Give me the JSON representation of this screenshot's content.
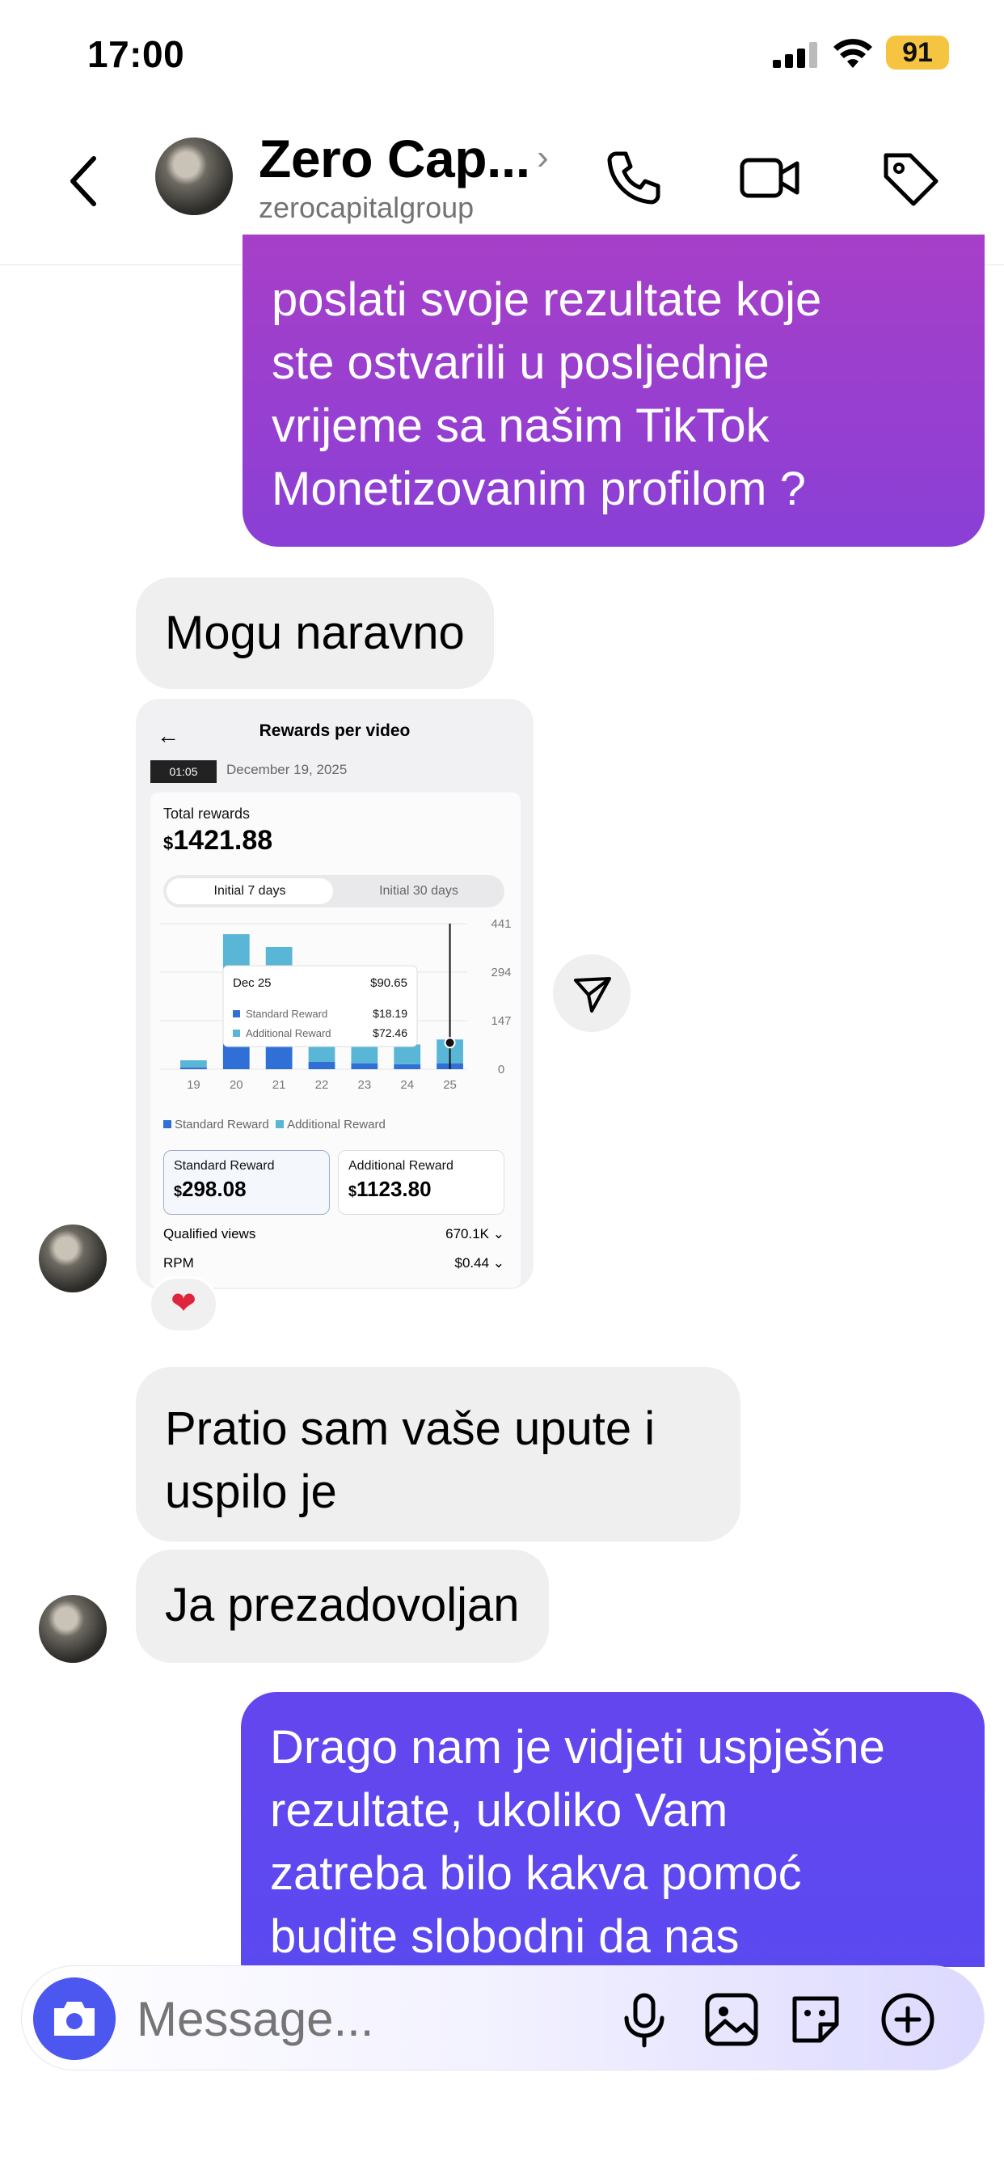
{
  "status_bar": {
    "time": "17:00",
    "battery": "91"
  },
  "header": {
    "title": "Zero Cap...",
    "subtitle": "zerocapitalgroup"
  },
  "messages": {
    "m1_lines": [
      "poslati svoje rezultate koje",
      "ste ostvarili u posljednje",
      "vrijeme sa našim TikTok",
      "Monetizovanim profilom ?"
    ],
    "m2": "Mogu naravno",
    "m4_lines": [
      "Pratio sam vaše upute i",
      "uspilo je"
    ],
    "m5": "Ja prezadovoljan",
    "m6_lines": [
      "Drago nam je vidjeti uspješne",
      "rezultate, ukoliko Vam",
      "zatreba bilo kakva pomoć",
      "budite slobodni da nas"
    ]
  },
  "shared_screenshot": {
    "title": "Rewards per video",
    "thumb_time": "01:05",
    "date": "December 19, 2025",
    "total_label": "Total rewards",
    "total_currency": "$",
    "total_value": "1421.88",
    "tab_active": "Initial 7 days",
    "tab_inactive": "Initial 30 days",
    "tooltip": {
      "date": "Dec 25",
      "total": "$90.65",
      "standard_label": "Standard Reward",
      "standard_value": "$18.19",
      "additional_label": "Additional Reward",
      "additional_value": "$72.46"
    },
    "legend_standard": "Standard Reward",
    "legend_additional": "Additional Reward",
    "standard_card_label": "Standard Reward",
    "standard_card_value": "298.08",
    "additional_card_label": "Additional Reward",
    "additional_card_value": "1123.80",
    "qualified_views_label": "Qualified views",
    "qualified_views_value": "670.1K",
    "rpm_label": "RPM",
    "rpm_value": "$0.44",
    "colors": {
      "standard": "#2f6fd6",
      "additional": "#5ab6d6"
    }
  },
  "chart_data": {
    "type": "bar",
    "categories": [
      "19",
      "20",
      "21",
      "22",
      "23",
      "24",
      "25"
    ],
    "series": [
      {
        "name": "Standard Reward",
        "values": [
          5,
          100,
          90,
          22,
          18,
          15,
          18
        ]
      },
      {
        "name": "Additional Reward",
        "values": [
          22,
          309,
          280,
          128,
          82,
          60,
          72
        ]
      }
    ],
    "yticks": [
      "441",
      "294",
      "147",
      "0"
    ],
    "ylim": [
      0,
      441
    ],
    "stacked": true
  },
  "reaction": "❤",
  "composer": {
    "placeholder": "Message..."
  }
}
